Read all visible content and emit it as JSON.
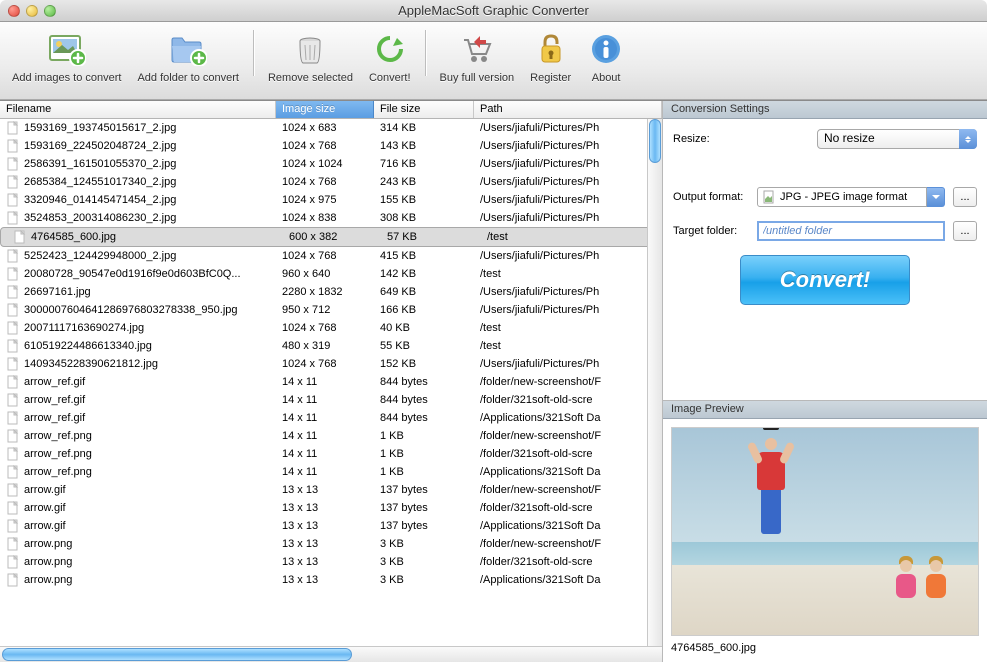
{
  "window": {
    "title": "AppleMacSoft Graphic Converter"
  },
  "toolbar": {
    "add_images": "Add images to convert",
    "add_folder": "Add folder to convert",
    "remove": "Remove selected",
    "convert": "Convert!",
    "buy": "Buy full version",
    "register": "Register",
    "about": "About"
  },
  "columns": {
    "filename": "Filename",
    "image_size": "Image size",
    "file_size": "File size",
    "path": "Path"
  },
  "rows": [
    {
      "fn": "1593169_193745015617_2.jpg",
      "sz": "1024 x 683",
      "fs": "314 KB",
      "pt": "/Users/jiafuli/Pictures/Ph"
    },
    {
      "fn": "1593169_224502048724_2.jpg",
      "sz": "1024 x 768",
      "fs": "143 KB",
      "pt": "/Users/jiafuli/Pictures/Ph"
    },
    {
      "fn": "2586391_161501055370_2.jpg",
      "sz": "1024 x 1024",
      "fs": "716 KB",
      "pt": "/Users/jiafuli/Pictures/Ph"
    },
    {
      "fn": "2685384_124551017340_2.jpg",
      "sz": "1024 x 768",
      "fs": "243 KB",
      "pt": "/Users/jiafuli/Pictures/Ph"
    },
    {
      "fn": "3320946_014145471454_2.jpg",
      "sz": "1024 x 975",
      "fs": "155 KB",
      "pt": "/Users/jiafuli/Pictures/Ph"
    },
    {
      "fn": "3524853_200314086230_2.jpg",
      "sz": "1024 x 838",
      "fs": "308 KB",
      "pt": "/Users/jiafuli/Pictures/Ph"
    },
    {
      "fn": "4764585_600.jpg",
      "sz": "600 x 382",
      "fs": "57 KB",
      "pt": "/test",
      "sel": true
    },
    {
      "fn": "5252423_124429948000_2.jpg",
      "sz": "1024 x 768",
      "fs": "415 KB",
      "pt": "/Users/jiafuli/Pictures/Ph"
    },
    {
      "fn": "20080728_90547e0d1916f9e0d603BfC0Q...",
      "sz": "960 x 640",
      "fs": "142 KB",
      "pt": "/test"
    },
    {
      "fn": "26697161.jpg",
      "sz": "2280 x 1832",
      "fs": "649 KB",
      "pt": "/Users/jiafuli/Pictures/Ph"
    },
    {
      "fn": "3000007604641286976803278338_950.jpg",
      "sz": "950 x 712",
      "fs": "166 KB",
      "pt": "/Users/jiafuli/Pictures/Ph"
    },
    {
      "fn": "20071117163690274.jpg",
      "sz": "1024 x 768",
      "fs": "40 KB",
      "pt": "/test"
    },
    {
      "fn": "610519224486613340.jpg",
      "sz": "480 x 319",
      "fs": "55 KB",
      "pt": "/test"
    },
    {
      "fn": "1409345228390621812.jpg",
      "sz": "1024 x 768",
      "fs": "152 KB",
      "pt": "/Users/jiafuli/Pictures/Ph"
    },
    {
      "fn": "arrow_ref.gif",
      "sz": "14 x 11",
      "fs": "844 bytes",
      "pt": "/folder/new-screenshot/F"
    },
    {
      "fn": "arrow_ref.gif",
      "sz": "14 x 11",
      "fs": "844 bytes",
      "pt": "/folder/321soft-old-scre"
    },
    {
      "fn": "arrow_ref.gif",
      "sz": "14 x 11",
      "fs": "844 bytes",
      "pt": "/Applications/321Soft Da"
    },
    {
      "fn": "arrow_ref.png",
      "sz": "14 x 11",
      "fs": "1 KB",
      "pt": "/folder/new-screenshot/F"
    },
    {
      "fn": "arrow_ref.png",
      "sz": "14 x 11",
      "fs": "1 KB",
      "pt": "/folder/321soft-old-scre"
    },
    {
      "fn": "arrow_ref.png",
      "sz": "14 x 11",
      "fs": "1 KB",
      "pt": "/Applications/321Soft Da"
    },
    {
      "fn": "arrow.gif",
      "sz": "13 x 13",
      "fs": "137 bytes",
      "pt": "/folder/new-screenshot/F"
    },
    {
      "fn": "arrow.gif",
      "sz": "13 x 13",
      "fs": "137 bytes",
      "pt": "/folder/321soft-old-scre"
    },
    {
      "fn": "arrow.gif",
      "sz": "13 x 13",
      "fs": "137 bytes",
      "pt": "/Applications/321Soft Da"
    },
    {
      "fn": "arrow.png",
      "sz": "13 x 13",
      "fs": "3 KB",
      "pt": "/folder/new-screenshot/F"
    },
    {
      "fn": "arrow.png",
      "sz": "13 x 13",
      "fs": "3 KB",
      "pt": "/folder/321soft-old-scre"
    },
    {
      "fn": "arrow.png",
      "sz": "13 x 13",
      "fs": "3 KB",
      "pt": "/Applications/321Soft Da"
    }
  ],
  "settings": {
    "heading": "Conversion Settings",
    "resize_label": "Resize:",
    "resize_value": "No resize",
    "output_label": "Output format:",
    "output_value": "JPG - JPEG image format",
    "target_label": "Target folder:",
    "target_value": "/untitled folder",
    "convert_button": "Convert!",
    "dots": "..."
  },
  "preview": {
    "heading": "Image Preview",
    "filename": "4764585_600.jpg"
  }
}
